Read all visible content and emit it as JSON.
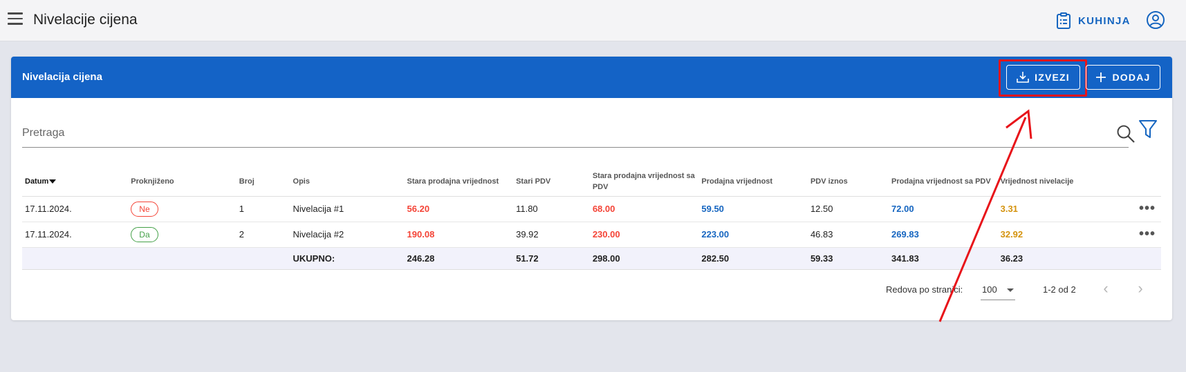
{
  "appbar": {
    "title": "Nivelacije cijena",
    "kitchen_label": "KUHINJA"
  },
  "card": {
    "title": "Nivelacija cijena",
    "export_label": "IZVEZI",
    "add_label": "DODAJ"
  },
  "search": {
    "placeholder": "Pretraga"
  },
  "table": {
    "columns": [
      "Datum",
      "Proknjiženo",
      "Broj",
      "Opis",
      "Stara prodajna vrijednost",
      "Stari PDV",
      "Stara prodajna vrijednost sa PDV",
      "Prodajna vrijednost",
      "PDV iznos",
      "Prodajna vrijednost sa PDV",
      "Vrijednost nivelacije"
    ],
    "rows": [
      {
        "date": "17.11.2024.",
        "posted": "Ne",
        "number": "1",
        "description": "Nivelacija #1",
        "old_value": "56.20",
        "old_vat": "11.80",
        "old_value_vat": "68.00",
        "value": "59.50",
        "vat": "12.50",
        "value_vat": "72.00",
        "leveling": "3.31"
      },
      {
        "date": "17.11.2024.",
        "posted": "Da",
        "number": "2",
        "description": "Nivelacija #2",
        "old_value": "190.08",
        "old_vat": "39.92",
        "old_value_vat": "230.00",
        "value": "223.00",
        "vat": "46.83",
        "value_vat": "269.83",
        "leveling": "32.92"
      }
    ],
    "total": {
      "label": "UKUPNO:",
      "old_value": "246.28",
      "old_vat": "51.72",
      "old_value_vat": "298.00",
      "value": "282.50",
      "vat": "59.33",
      "value_vat": "341.83",
      "leveling": "36.23"
    }
  },
  "pager": {
    "rows_per_page_label": "Redova po stranici:",
    "rows_per_page": "100",
    "range": "1-2 od 2"
  },
  "colors": {
    "primary": "#1463c6",
    "red": "#f44336",
    "green": "#43a047",
    "gold": "#d4920c",
    "annotation": "#e8141a"
  }
}
